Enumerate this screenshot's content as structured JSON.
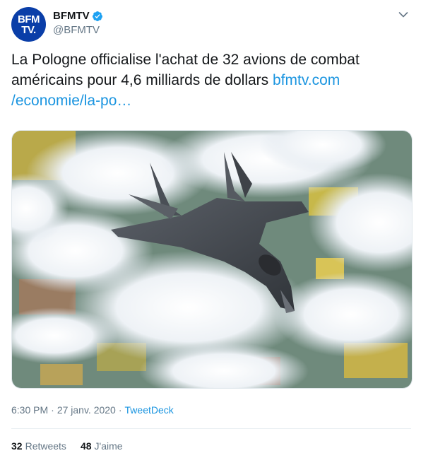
{
  "author": {
    "display_name": "BFMTV",
    "handle": "@BFMTV",
    "avatar_line1": "BFM",
    "avatar_line2": "TV."
  },
  "tweet": {
    "text": "La Pologne officialise l'achat de 32 avions de combat américains pour 4,6 milliards de dollars ",
    "link_text": "bfmtv.com\n/economie/la-po…"
  },
  "meta": {
    "time": "6:30 PM",
    "date": "27 janv. 2020",
    "separator": "·",
    "source": "TweetDeck"
  },
  "stats": {
    "retweets_count": "32",
    "retweets_label": "Retweets",
    "likes_count": "48",
    "likes_label": "J'aime"
  },
  "colors": {
    "link": "#1b95e0",
    "secondary_text": "#657786",
    "avatar_bg": "#0a3ea8",
    "verified": "#1da1f2"
  },
  "icons": {
    "verified": "verified-badge-icon",
    "menu": "chevron-down-icon"
  }
}
